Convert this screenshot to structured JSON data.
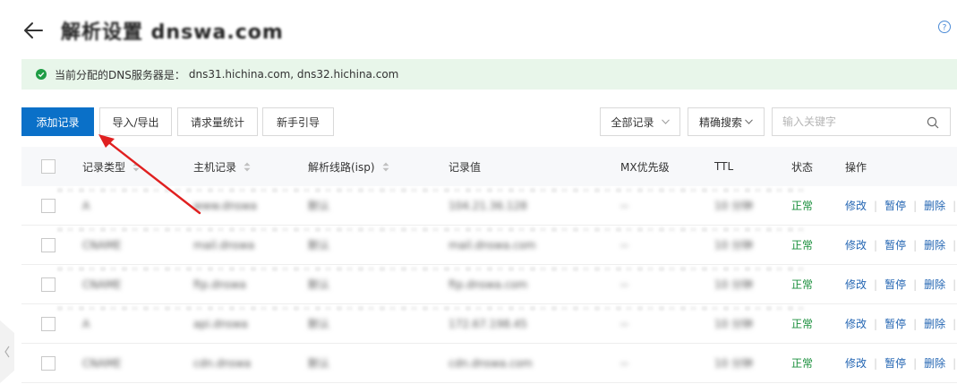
{
  "header": {
    "title": "解析设置 dnswa.com"
  },
  "notice": {
    "label": "当前分配的DNS服务器是：",
    "servers": "dns31.hichina.com, dns32.hichina.com"
  },
  "toolbar": {
    "add_label": "添加记录",
    "import_export_label": "导入/导出",
    "stats_label": "请求量统计",
    "guide_label": "新手引导",
    "filter_all_label": "全部记录",
    "precise_search_label": "精确搜索",
    "search_placeholder": "输入关键字"
  },
  "table": {
    "columns": {
      "type": "记录类型",
      "host": "主机记录",
      "line": "解析线路(isp)",
      "value": "记录值",
      "mx": "MX优先级",
      "ttl": "TTL",
      "status": "状态",
      "ops": "操作"
    },
    "rows": [
      {
        "type": "A",
        "host": "www.dnswa",
        "line": "默认",
        "value": "104.21.36.128",
        "mx": "--",
        "ttl": "10 分钟",
        "status": "正常",
        "modify": "修改",
        "pause": "暂停",
        "delete": "删除"
      },
      {
        "type": "CNAME",
        "host": "mail.dnswa",
        "line": "默认",
        "value": "mail.dnswa.com",
        "mx": "--",
        "ttl": "10 分钟",
        "status": "正常",
        "modify": "修改",
        "pause": "暂停",
        "delete": "删除"
      },
      {
        "type": "CNAME",
        "host": "ftp.dnswa",
        "line": "默认",
        "value": "ftp.dnswa.com",
        "mx": "--",
        "ttl": "10 分钟",
        "status": "正常",
        "modify": "修改",
        "pause": "暂停",
        "delete": "删除"
      },
      {
        "type": "A",
        "host": "api.dnswa",
        "line": "默认",
        "value": "172.67.198.45",
        "mx": "--",
        "ttl": "10 分钟",
        "status": "正常",
        "modify": "修改",
        "pause": "暂停",
        "delete": "删除"
      },
      {
        "type": "CNAME",
        "host": "cdn.dnswa",
        "line": "默认",
        "value": "cdn.dnswa.com",
        "mx": "--",
        "ttl": "10 分钟",
        "status": "正常",
        "modify": "修改",
        "pause": "暂停",
        "delete": "删除"
      }
    ]
  },
  "icons": {
    "back": "arrow-left-icon",
    "help": "question-circle-icon",
    "ok": "check-circle-icon",
    "sort": "sort-icon",
    "chevron": "chevron-down-icon",
    "search": "search-icon"
  },
  "colors": {
    "primary": "#0a70c8",
    "notice_bg": "#e8f6ea",
    "status_ok": "#1a8f3c",
    "link": "#2466b3",
    "annotation_arrow": "#e02020"
  }
}
